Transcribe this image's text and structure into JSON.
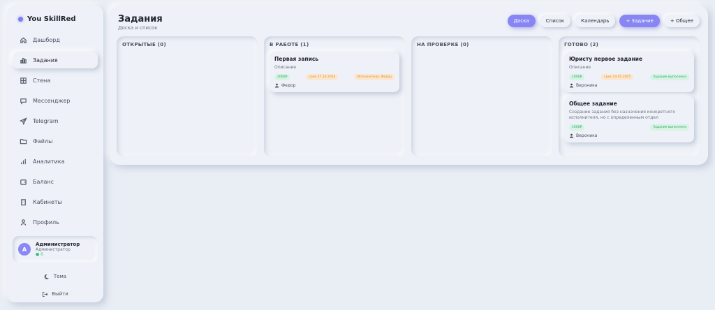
{
  "brand": {
    "name": "You SkillRed"
  },
  "sidebar": {
    "items": [
      {
        "label": "Дашборд",
        "icon": "home-icon"
      },
      {
        "label": "Задания",
        "icon": "bar-chart-icon"
      },
      {
        "label": "Стена",
        "icon": "grid-icon"
      },
      {
        "label": "Мессенджер",
        "icon": "chat-icon"
      },
      {
        "label": "Telegram",
        "icon": "send-icon"
      },
      {
        "label": "Файлы",
        "icon": "folder-icon"
      },
      {
        "label": "Аналитика",
        "icon": "analytics-icon"
      },
      {
        "label": "Баланс",
        "icon": "wallet-icon"
      },
      {
        "label": "Кабинеты",
        "icon": "building-icon"
      },
      {
        "label": "Профиль",
        "icon": "user-icon"
      }
    ],
    "active_index": 1
  },
  "user": {
    "initial": "А",
    "name": "Администратор",
    "role": "Администратор",
    "status": "● 0"
  },
  "footer": {
    "theme_label": "Тема",
    "logout_label": "Выйти"
  },
  "header": {
    "title": "Задания",
    "subtitle": "Доска и список",
    "buttons": {
      "board": "Доска",
      "list": "Список",
      "calendar": "Календарь",
      "add_task": "+ Задание",
      "common": "+ Общее"
    }
  },
  "columns": [
    {
      "title": "ОТКРЫТЫЕ (0)",
      "cards": []
    },
    {
      "title": "В РАБОТЕ (1)",
      "cards": [
        {
          "title": "Первая запись",
          "desc": "Описание",
          "tags": [
            "2000₽",
            "срок 27.10.2024",
            "Исполнитель: Федор"
          ],
          "assignee": "Федор"
        }
      ]
    },
    {
      "title": "НА ПРОВЕРКЕ (0)",
      "cards": []
    },
    {
      "title": "ГОТОВО (2)",
      "cards": [
        {
          "title": "Юристу первое задание",
          "desc": "Описание",
          "tags": [
            "1000₽",
            "срок 14.05.2025",
            "Задание выполнено"
          ],
          "assignee": "Вероника"
        },
        {
          "title": "Общее задание",
          "desc": "Создание задания без назначения конкретного исполнителя, но с определенным отдел",
          "tags": [
            "1000₽",
            "Задание выполнено"
          ],
          "assignee": "Вероника"
        }
      ]
    }
  ],
  "colors": {
    "accent": "#8786f2",
    "green": "#2fa866",
    "orange": "#e08a2c",
    "background": "#e9edf4"
  }
}
